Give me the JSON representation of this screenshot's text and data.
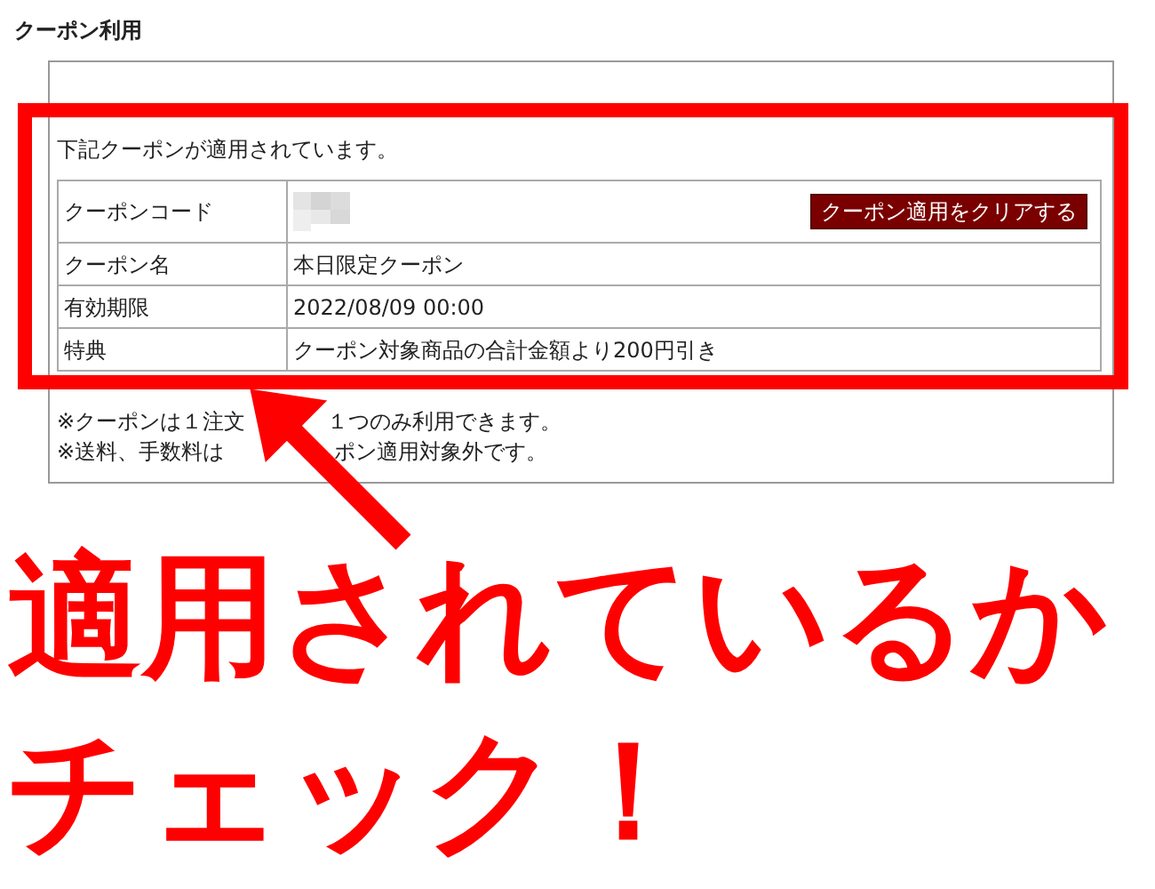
{
  "section_title": "クーポン利用",
  "applied_message": "下記クーポンが適用されています。",
  "rows": [
    {
      "kind": "code",
      "label": "クーポンコード",
      "button": "クーポン適用をクリアする"
    },
    {
      "kind": "text",
      "label": "クーポン名",
      "value": "本日限定クーポン"
    },
    {
      "kind": "text",
      "label": "有効期限",
      "value": "2022/08/09 00:00"
    },
    {
      "kind": "text",
      "label": "特典",
      "value": "クーポン対象商品の合計金額より200円引き"
    }
  ],
  "notes": [
    [
      "※クーポンは１注文",
      "１つのみ利用できます。"
    ],
    [
      "※送料、手数料は",
      "ポン適用対象外です。"
    ]
  ],
  "annotation": {
    "caption_lines": [
      "適用されているか",
      "チェック！"
    ]
  }
}
